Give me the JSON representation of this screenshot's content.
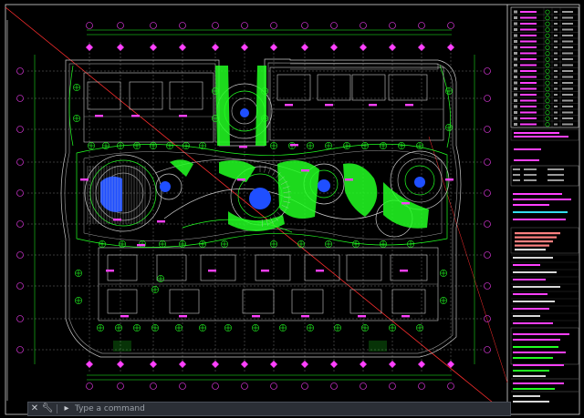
{
  "command_bar": {
    "placeholder": "Type a command",
    "close_icon": "close-icon",
    "wrench_icon": "wrench-icon",
    "prompt_icon": "command-prompt-icon"
  },
  "colors": {
    "background": "#000000",
    "frame": "#e8e8e8",
    "magenta": "#ff40ff",
    "green": "#22ff22",
    "grey": "#9a9a9a",
    "cyan": "#33ddee",
    "blue": "#2255ff",
    "red": "#ff3030",
    "yellow": "#ffff33"
  }
}
